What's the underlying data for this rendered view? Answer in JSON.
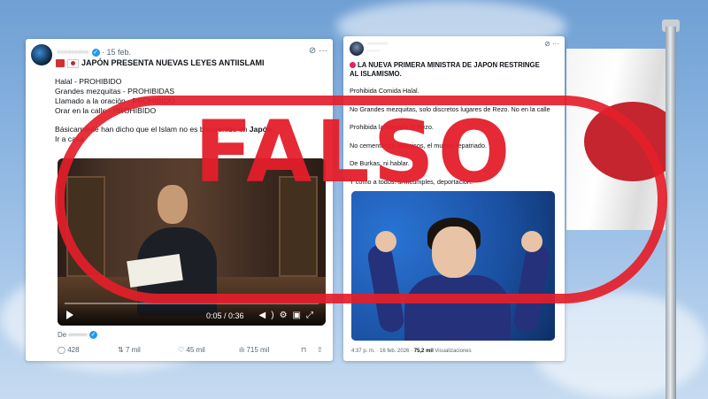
{
  "colors": {
    "stamp_red": "#e41e2a",
    "link_blue": "#1d9bf0",
    "flag_red": "#c4252e"
  },
  "stamp": {
    "text": "FALSO"
  },
  "post1": {
    "handle": "·········",
    "date": "· 15 feb.",
    "title": "JAPÓN PRESENTA NUEVAS LEYES ANTIISLAMI",
    "lines": [
      "Halal - PROHIBIDO",
      "Grandes mezquitas - PROHIBIDAS",
      "Llamado a la oración - PROHIBIDO",
      "Orar en la calle - PROHIBIDO"
    ],
    "para_prefix": "Básicamente han dicho que el Islam no es bienvenido en ",
    "para_bold": "Japón",
    "para_suffix": ".",
    "para2": "Ir a casa",
    "video_time": "0:05 / 0:36",
    "from_label": "De",
    "from_handle": "········",
    "replies": "428",
    "reposts": "7 mil",
    "likes": "45 mil",
    "views": "715 mil",
    "icons": [
      "grok-icon",
      "more-icon",
      "play-icon",
      "volume-icon",
      "settings-icon",
      "fullscreen-icon"
    ]
  },
  "post2": {
    "handle": "··········",
    "sub": "·······",
    "title": "LA NUEVA PRIMERA MINISTRA DE JAPON RESTRINGE AL ISLAMISMO.",
    "lines": [
      "Prohibida Comida Halal.",
      "No Grandes mezquitas, solo discretos lugares de Rezo. No en la calle",
      "Prohibida la llamada al Rezo.",
      "No cementerios Islámicos, el muerto repatriado.",
      "De Burkas, ni hablar.",
      "Y como a todos: si incumples, deportación."
    ],
    "meta": "4:37 p. m. · 16 feb. 2026 · ",
    "views": "75,2 mil",
    "views_label": " Visualizaciones"
  }
}
